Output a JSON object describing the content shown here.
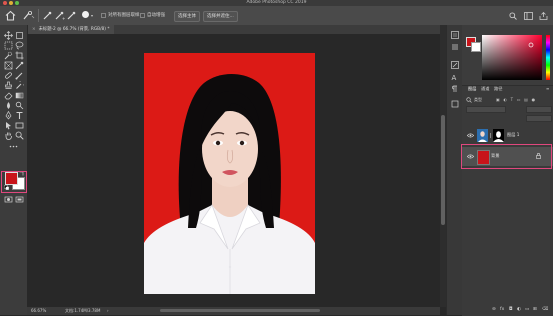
{
  "app": {
    "title": "Adobe Photoshop CC 2019"
  },
  "options": {
    "sample_all_layers": "对所有图层取样",
    "auto_enhance": "自动增强",
    "select_subject": "选择主体",
    "select_and_mask": "选择并遮住..."
  },
  "document": {
    "tab_label": "未标题-2 @ 66.7% (背景, RGB/8) *"
  },
  "status": {
    "zoom": "66.67%",
    "doc_size": "文档:1.74M/3.78M"
  },
  "colors": {
    "foreground": "#c8141a",
    "background": "#ffffff",
    "canvas_bg": "#dc1a16",
    "highlight": "#e0487e"
  },
  "layers_panel": {
    "tabs": [
      "图层",
      "通道",
      "路径"
    ],
    "filter_label": "类型",
    "layers": [
      {
        "name": "图层 1",
        "visible": true,
        "icon": "portrait-thumbnail"
      },
      {
        "name": "背景",
        "visible": true,
        "icon": "red-thumbnail",
        "locked": true
      }
    ]
  }
}
